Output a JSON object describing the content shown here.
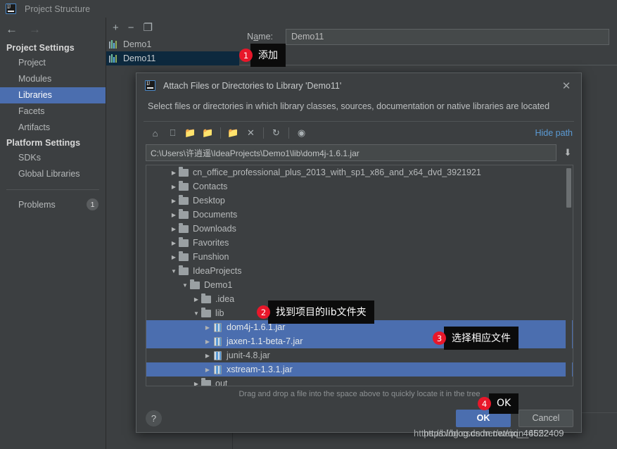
{
  "window": {
    "title": "Project Structure",
    "logo_icon": "intellij-idea-logo-icon"
  },
  "nav": {
    "back_icon": "arrow-left-icon",
    "forward_icon": "arrow-right-icon"
  },
  "sidebar": {
    "sections": [
      {
        "title": "Project Settings",
        "items": [
          "Project",
          "Modules",
          "Libraries",
          "Facets",
          "Artifacts"
        ]
      },
      {
        "title": "Platform Settings",
        "items": [
          "SDKs",
          "Global Libraries"
        ]
      }
    ],
    "selected": "Libraries",
    "problems": {
      "label": "Problems",
      "count": "1"
    }
  },
  "library_panel": {
    "toolbar": [
      {
        "name": "add-library-button",
        "glyph": "+"
      },
      {
        "name": "remove-library-button",
        "glyph": "−"
      },
      {
        "name": "copy-library-button",
        "glyph": "❐"
      }
    ],
    "items": [
      {
        "label": "Demo1",
        "selected": false
      },
      {
        "label": "Demo11",
        "selected": true
      }
    ]
  },
  "detail": {
    "name_label": "Name:",
    "name_value": "Demo11",
    "name_placeholder": "Name",
    "add_buttons": [
      {
        "name": "add-jar-button",
        "glyph": "+",
        "enabled": true
      },
      {
        "name": "add-exclude-button",
        "glyph": "+",
        "enabled": true
      },
      {
        "name": "add-module-button",
        "glyph": "+",
        "enabled": false
      },
      {
        "name": "remove-item-button",
        "glyph": "−",
        "enabled": true
      }
    ]
  },
  "dialog": {
    "title": "Attach Files or Directories to Library 'Demo11'",
    "subtitle": "Select files or directories in which library classes, sources, documentation or native libraries are located",
    "close_icon": "close-icon",
    "toolbar": [
      {
        "name": "home-icon",
        "glyph": "⌂",
        "enabled": true
      },
      {
        "name": "desktop-icon",
        "glyph": "▭",
        "enabled": true
      },
      {
        "name": "project-folder-icon",
        "glyph": "☰",
        "enabled": true
      },
      {
        "name": "module-folder-icon",
        "glyph": "☰",
        "enabled": false
      },
      {
        "name": "new-folder-icon",
        "glyph": "⊞",
        "enabled": true
      },
      {
        "name": "delete-icon",
        "glyph": "✕",
        "enabled": true
      },
      {
        "name": "refresh-icon",
        "glyph": "⟳",
        "enabled": true
      },
      {
        "name": "show-hidden-files-icon",
        "glyph": "⌘",
        "enabled": true
      }
    ],
    "hide_path_label": "Hide path",
    "path_value": "C:\\Users\\许逍遥\\IdeaProjects\\Demo1\\lib\\dom4j-1.6.1.jar",
    "path_placeholder": "Path",
    "download_icon": "import-path-icon",
    "tree": [
      {
        "indent": 2,
        "twisty": "▶",
        "type": "folder",
        "label": "cn_office_professional_plus_2013_with_sp1_x86_and_x64_dvd_3921921",
        "selected": false
      },
      {
        "indent": 2,
        "twisty": "▶",
        "type": "folder",
        "label": "Contacts",
        "selected": false
      },
      {
        "indent": 2,
        "twisty": "▶",
        "type": "folder",
        "label": "Desktop",
        "selected": false
      },
      {
        "indent": 2,
        "twisty": "▶",
        "type": "folder",
        "label": "Documents",
        "selected": false
      },
      {
        "indent": 2,
        "twisty": "▶",
        "type": "folder",
        "label": "Downloads",
        "selected": false
      },
      {
        "indent": 2,
        "twisty": "▶",
        "type": "folder",
        "label": "Favorites",
        "selected": false
      },
      {
        "indent": 2,
        "twisty": "▶",
        "type": "folder",
        "label": "Funshion",
        "selected": false
      },
      {
        "indent": 2,
        "twisty": "▼",
        "type": "folder",
        "label": "IdeaProjects",
        "selected": false
      },
      {
        "indent": 3,
        "twisty": "▼",
        "type": "folder",
        "label": "Demo1",
        "selected": false
      },
      {
        "indent": 4,
        "twisty": "▶",
        "type": "folder",
        "label": ".idea",
        "selected": false
      },
      {
        "indent": 4,
        "twisty": "▼",
        "type": "folder",
        "label": "lib",
        "selected": false
      },
      {
        "indent": 5,
        "twisty": "▶",
        "type": "jar",
        "label": "dom4j-1.6.1.jar",
        "selected": true
      },
      {
        "indent": 5,
        "twisty": "▶",
        "type": "jar",
        "label": "jaxen-1.1-beta-7.jar",
        "selected": true
      },
      {
        "indent": 5,
        "twisty": "▶",
        "type": "jar",
        "label": "junit-4.8.jar",
        "selected": false
      },
      {
        "indent": 5,
        "twisty": "▶",
        "type": "jar",
        "label": "xstream-1.3.1.jar",
        "selected": true
      },
      {
        "indent": 4,
        "twisty": "▶",
        "type": "folder",
        "label": "out",
        "selected": false
      }
    ],
    "drag_hint": "Drag and drop a file into the space above to quickly locate it in the tree",
    "help_label": "?",
    "ok_label": "OK",
    "cancel_label": "Cancel"
  },
  "annotations": [
    {
      "num": "1",
      "text": "添加"
    },
    {
      "num": "2",
      "text": "找到项目的lib文件夹"
    },
    {
      "num": "3",
      "text": "选择相应文件"
    },
    {
      "num": "4",
      "text": "OK"
    }
  ],
  "watermark": {
    "line_a": "https://blog.csdn.net/weixin_4652",
    "line_b": "https://blog.csdn.net/qq_46522409"
  },
  "colors": {
    "background": "#3c3f41",
    "selection_blue": "#4b6eaf",
    "list_selection": "#0d293e",
    "link_blue": "#5b9bd5",
    "badge_red": "#e8172a",
    "text_primary": "#b6b9ba"
  }
}
